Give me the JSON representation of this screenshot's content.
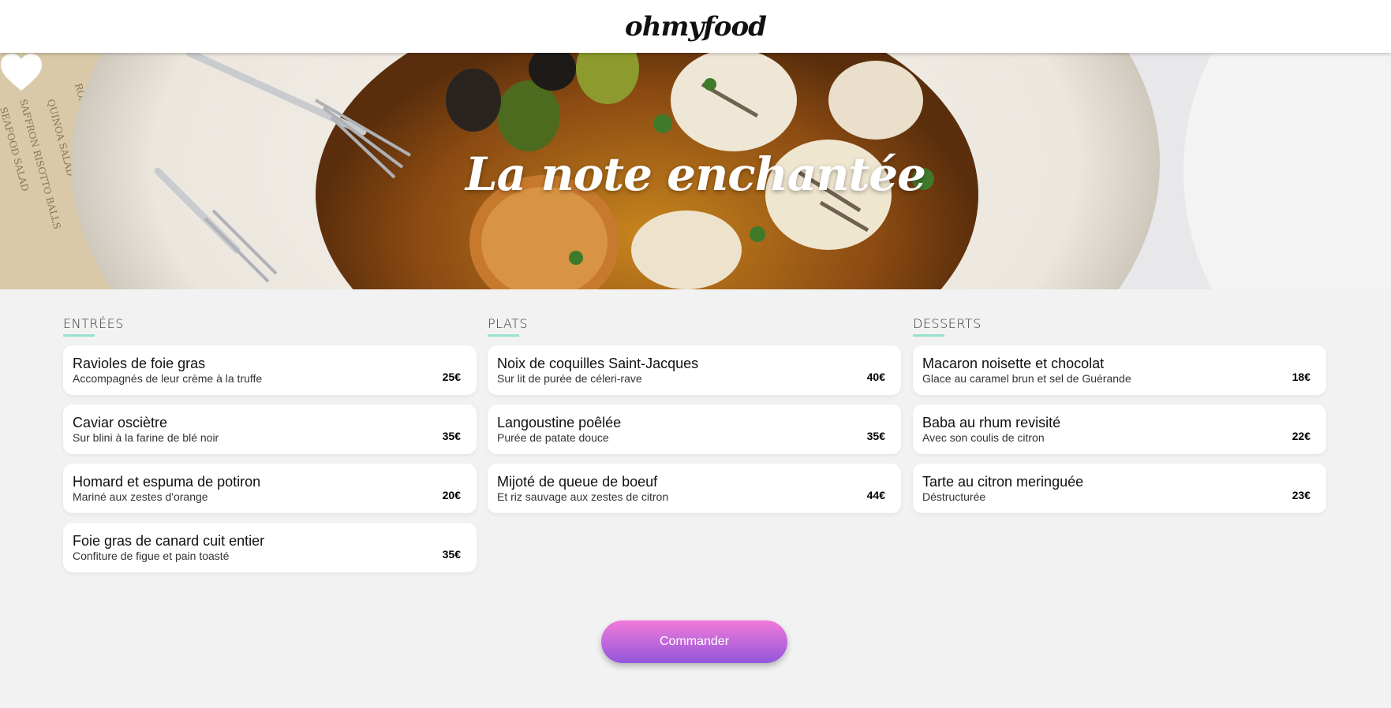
{
  "header": {
    "logo": "ohmyfood"
  },
  "hero": {
    "title": "La note enchantée",
    "favorite_icon": "heart-icon"
  },
  "menu": [
    {
      "title": "ENTRÉES",
      "items": [
        {
          "name": "Ravioles de foie gras",
          "desc": "Accompagnés de leur crème à la truffe",
          "price": "25€"
        },
        {
          "name": "Caviar osciètre",
          "desc": "Sur blini à la farine de blé noir",
          "price": "35€"
        },
        {
          "name": "Homard et espuma de potiron",
          "desc": "Mariné aux zestes d'orange",
          "price": "20€"
        },
        {
          "name": "Foie gras de canard cuit entier",
          "desc": "Confiture de figue et pain toasté",
          "price": "35€"
        }
      ]
    },
    {
      "title": "PLATS",
      "items": [
        {
          "name": "Noix de coquilles Saint-Jacques",
          "desc": "Sur lit de purée de céleri-rave",
          "price": "40€"
        },
        {
          "name": "Langoustine poêlée",
          "desc": "Purée de patate douce",
          "price": "35€"
        },
        {
          "name": "Mijoté de queue de boeuf",
          "desc": "Et riz sauvage aux zestes de citron",
          "price": "44€"
        }
      ]
    },
    {
      "title": "DESSERTS",
      "items": [
        {
          "name": "Macaron noisette et chocolat",
          "desc": "Glace au caramel brun et sel de Guérande",
          "price": "18€"
        },
        {
          "name": "Baba au rhum revisité",
          "desc": "Avec son coulis de citron",
          "price": "22€"
        },
        {
          "name": "Tarte au citron meringuée",
          "desc": "Déstructurée",
          "price": "23€"
        }
      ]
    }
  ],
  "order_button": {
    "label": "Commander"
  },
  "colors": {
    "accent_underline": "#99e2d0",
    "button_top": "#f27ad9",
    "button_bottom": "#9356dc",
    "background": "#f2f2f2"
  }
}
